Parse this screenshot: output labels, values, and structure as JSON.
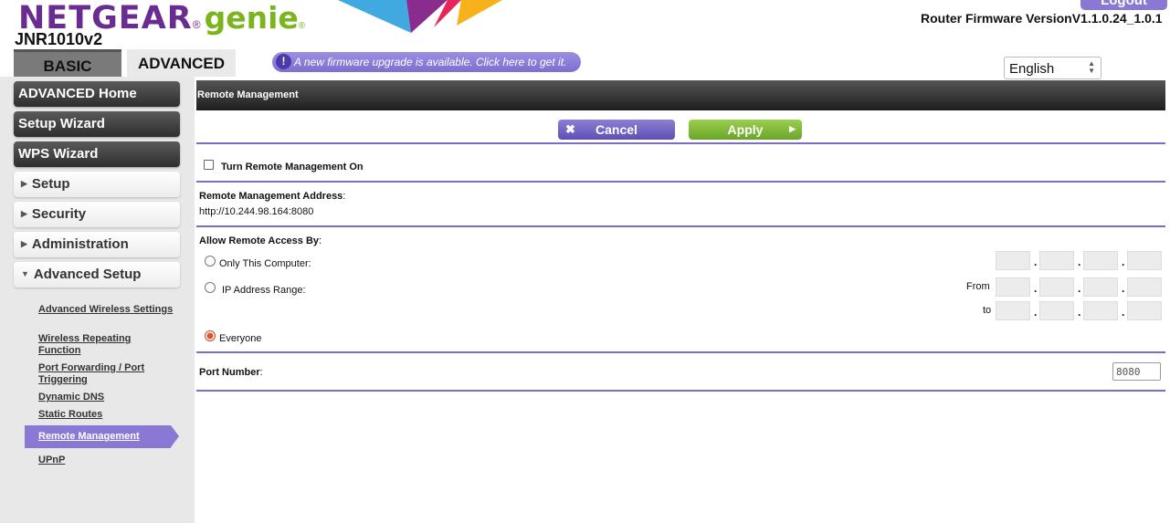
{
  "header": {
    "logo_netgear": "NETGEAR",
    "logo_reg": "®",
    "logo_genie": "genie",
    "logo_genie_reg": "®",
    "model": "JNR1010v2",
    "logout_label": "Logout",
    "firmware_label": "Router Firmware VersionV1.1.0.24_1.0.1",
    "tabs": [
      {
        "label": "BASIC"
      },
      {
        "label": "ADVANCED"
      }
    ],
    "firmware_notice": "A new firmware upgrade is available. Click here to get it.",
    "notice_icon": "!",
    "language_selected": "English"
  },
  "sidebar": {
    "main_items": [
      {
        "label": "ADVANCED Home"
      },
      {
        "label": "Setup Wizard"
      },
      {
        "label": "WPS Wizard"
      }
    ],
    "sections": [
      {
        "label": "Setup",
        "icon": "triangle-right-icon"
      },
      {
        "label": "Security",
        "icon": "triangle-right-icon"
      },
      {
        "label": "Administration",
        "icon": "triangle-right-icon"
      },
      {
        "label": "Advanced Setup",
        "icon": "triangle-down-icon"
      }
    ],
    "sublinks": [
      {
        "label": "Advanced Wireless Settings"
      },
      {
        "label": "Wireless Repeating Function"
      },
      {
        "label": "Port Forwarding / Port Triggering"
      },
      {
        "label": "Dynamic DNS"
      },
      {
        "label": "Static Routes"
      },
      {
        "label": "Remote Management"
      },
      {
        "label": "UPnP"
      }
    ],
    "active_sublink": "Remote Management"
  },
  "main": {
    "title": "Remote Management",
    "cancel_label": "Cancel",
    "apply_label": "Apply",
    "turn_on_label": "Turn Remote Management On",
    "turn_on_checked": false,
    "address_label": "Remote Management Address",
    "address_value": "http://10.244.98.164:8080",
    "allow_label": "Allow Remote Access By",
    "colon": ":",
    "options": [
      {
        "label": "Only This Computer:",
        "checked": false
      },
      {
        "label": "IP Address Range:",
        "checked": false
      },
      {
        "label": "Everyone",
        "checked": true
      }
    ],
    "from_label": "From",
    "to_label": "to",
    "ip_dot": ".",
    "port_label": "Port Number",
    "port_value": "8080"
  },
  "colors": {
    "accent_purple": "#7c6cc8",
    "apply_green": "#7ab51d",
    "brand_purple": "#6b2c91"
  }
}
